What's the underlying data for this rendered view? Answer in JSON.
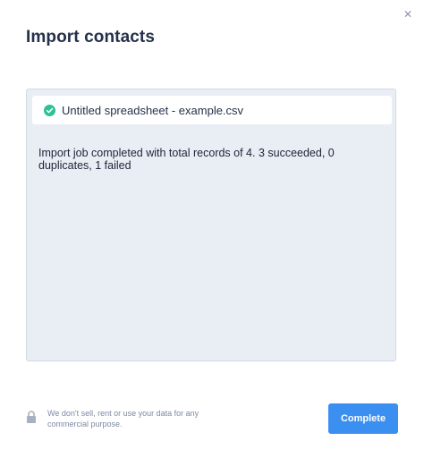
{
  "dialog": {
    "title": "Import contacts",
    "close_icon": "close-icon"
  },
  "file": {
    "name": "Untitled spreadsheet - example.csv",
    "status_icon": "check-circle-icon",
    "status_color": "#2cc197"
  },
  "result": {
    "message": "Import job completed with total records of 4. 3 succeeded, 0 duplicates, 1 failed"
  },
  "footer": {
    "privacy_icon": "lock-icon",
    "privacy_text": "We don't sell, rent or use your data for any commercial purpose.",
    "complete_label": "Complete",
    "accent_color": "#3b8ff0"
  }
}
